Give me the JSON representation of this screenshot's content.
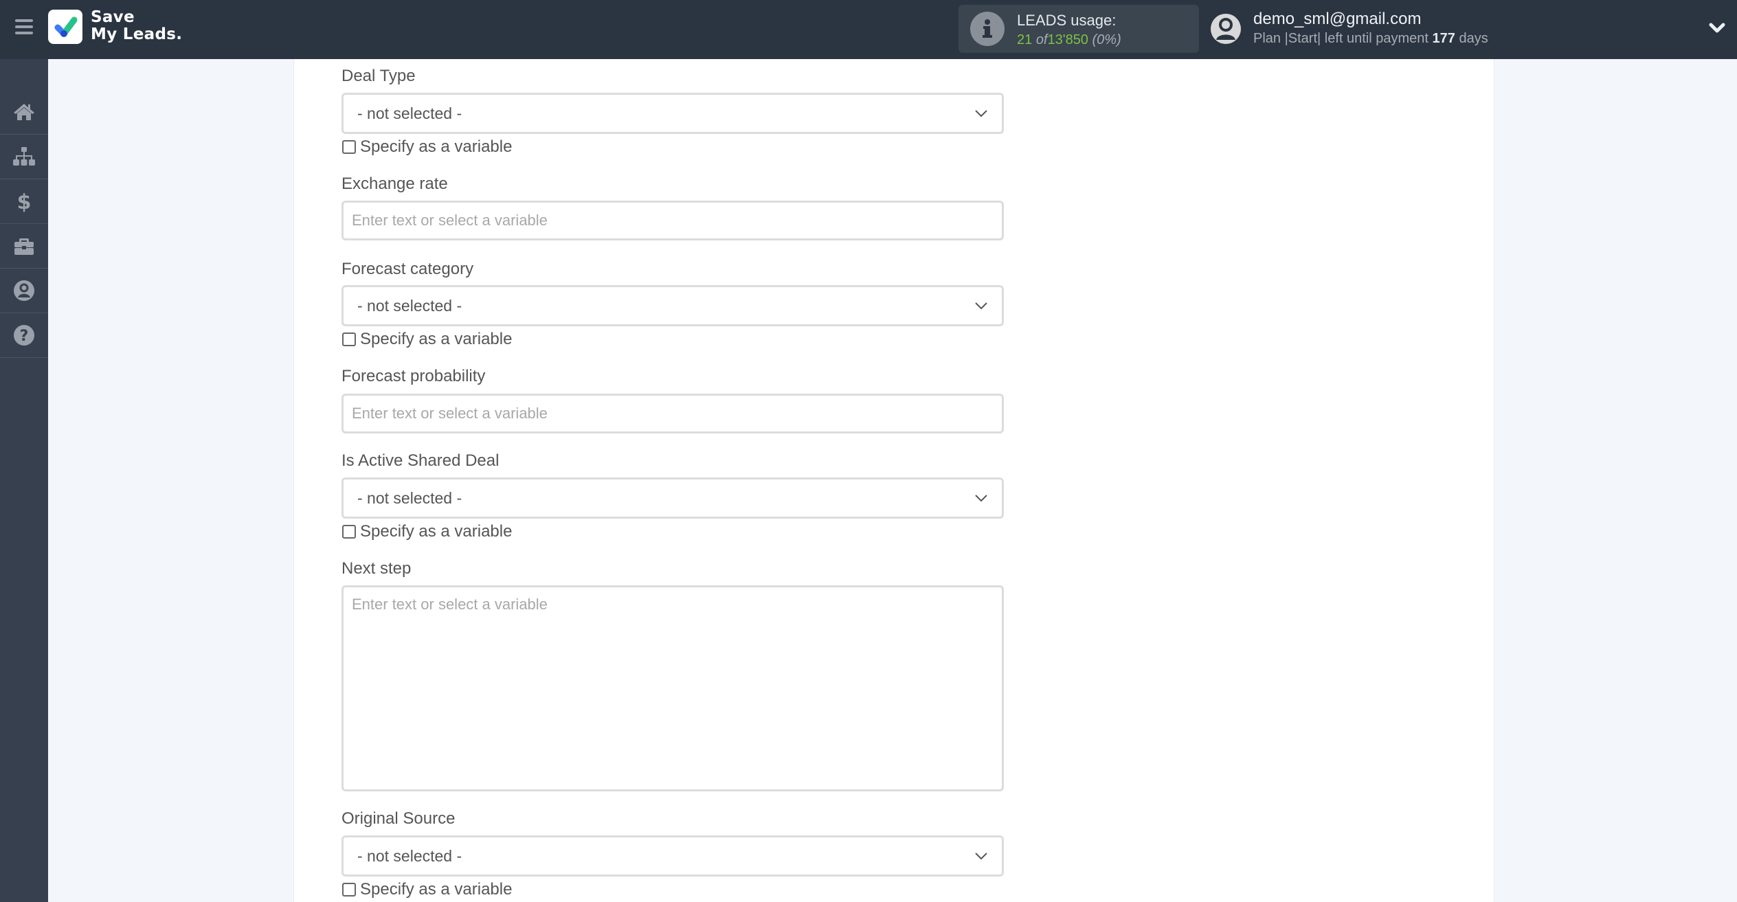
{
  "app": {
    "brand_line1": "Save",
    "brand_line2": "My Leads."
  },
  "header": {
    "leads_usage_label": "LEADS usage:",
    "leads_used": "21",
    "leads_of": "of",
    "leads_total": "13'850",
    "leads_percent": "(0%)",
    "user_email": "demo_sml@gmail.com",
    "plan_prefix": "Plan |Start| left until payment",
    "plan_days": "177",
    "plan_suffix": "days"
  },
  "sidebar": {
    "items": [
      {
        "name": "home",
        "icon": "home-icon"
      },
      {
        "name": "connections",
        "icon": "sitemap-icon"
      },
      {
        "name": "billing",
        "icon": "dollar-icon"
      },
      {
        "name": "tools",
        "icon": "briefcase-icon"
      },
      {
        "name": "account",
        "icon": "user-circle-icon"
      },
      {
        "name": "help",
        "icon": "question-circle-icon"
      }
    ]
  },
  "form": {
    "fields": [
      {
        "label": "Deal Type",
        "type": "select",
        "value": "- not selected -",
        "checkbox_label": "Specify as a variable",
        "checked": false
      },
      {
        "label": "Exchange rate",
        "type": "input",
        "value": "",
        "placeholder": "Enter text or select a variable"
      },
      {
        "label": "Forecast category",
        "type": "select",
        "value": "- not selected -",
        "checkbox_label": "Specify as a variable",
        "checked": false
      },
      {
        "label": "Forecast probability",
        "type": "input",
        "value": "",
        "placeholder": "Enter text or select a variable"
      },
      {
        "label": "Is Active Shared Deal",
        "type": "select",
        "value": "- not selected -",
        "checkbox_label": "Specify as a variable",
        "checked": false
      },
      {
        "label": "Next step",
        "type": "textarea",
        "value": "",
        "placeholder": "Enter text or select a variable"
      },
      {
        "label": "Original Source",
        "type": "select",
        "value": "- not selected -",
        "checkbox_label": "Specify as a variable",
        "checked": false
      }
    ]
  },
  "colors": {
    "header_bg": "#2b3441",
    "sidebar_bg": "#36404e",
    "page_bg": "#f3f6fb",
    "usage_green": "#7dc242",
    "logo_green": "#27c28a",
    "logo_blue": "#3b7bf6"
  }
}
